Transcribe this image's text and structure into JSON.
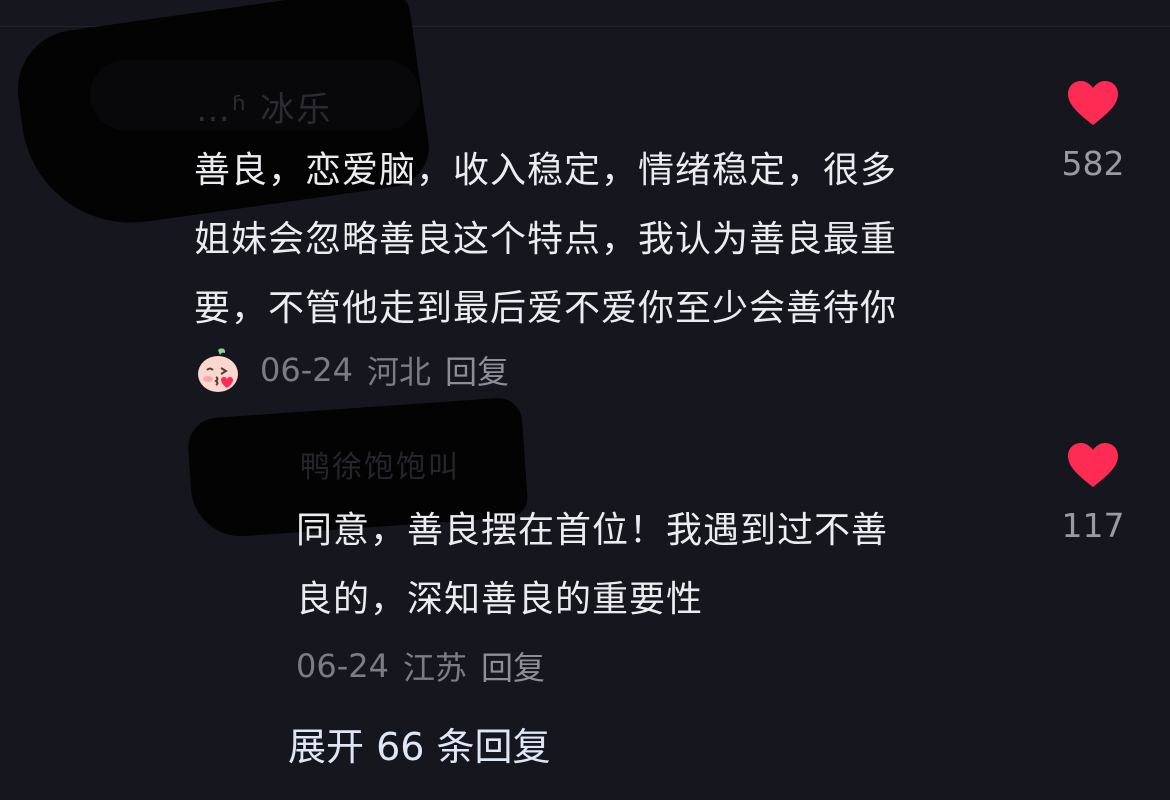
{
  "comments": [
    {
      "username": "…ʱ 冰乐",
      "text_lines": [
        "善良，恋爱脑，收入稳定，情绪稳定，很多",
        "姐妹会忽略善良这个特点，我认为善良最重",
        "要，不管他走到最后爱不爱你至少会善待你"
      ],
      "date": "06-24",
      "location": "河北",
      "reply_label": "回复",
      "like_count": "582"
    },
    {
      "username": "鸭徐饱饱叫",
      "text_lines": [
        "同意，善良摆在首位！我遇到过不善",
        "良的，深知善良的重要性"
      ],
      "date": "06-24",
      "location": "江苏",
      "reply_label": "回复",
      "like_count": "117"
    }
  ],
  "expand_replies_label": "展开 66 条回复",
  "colors": {
    "background": "#16161f",
    "like_heart": "#fe2c55",
    "meta_text": "#7c7c86",
    "expand_text": "#dfe7f7"
  },
  "icons": {
    "like": "heart-icon",
    "emoji": "blowing-kiss-emoji-icon"
  }
}
